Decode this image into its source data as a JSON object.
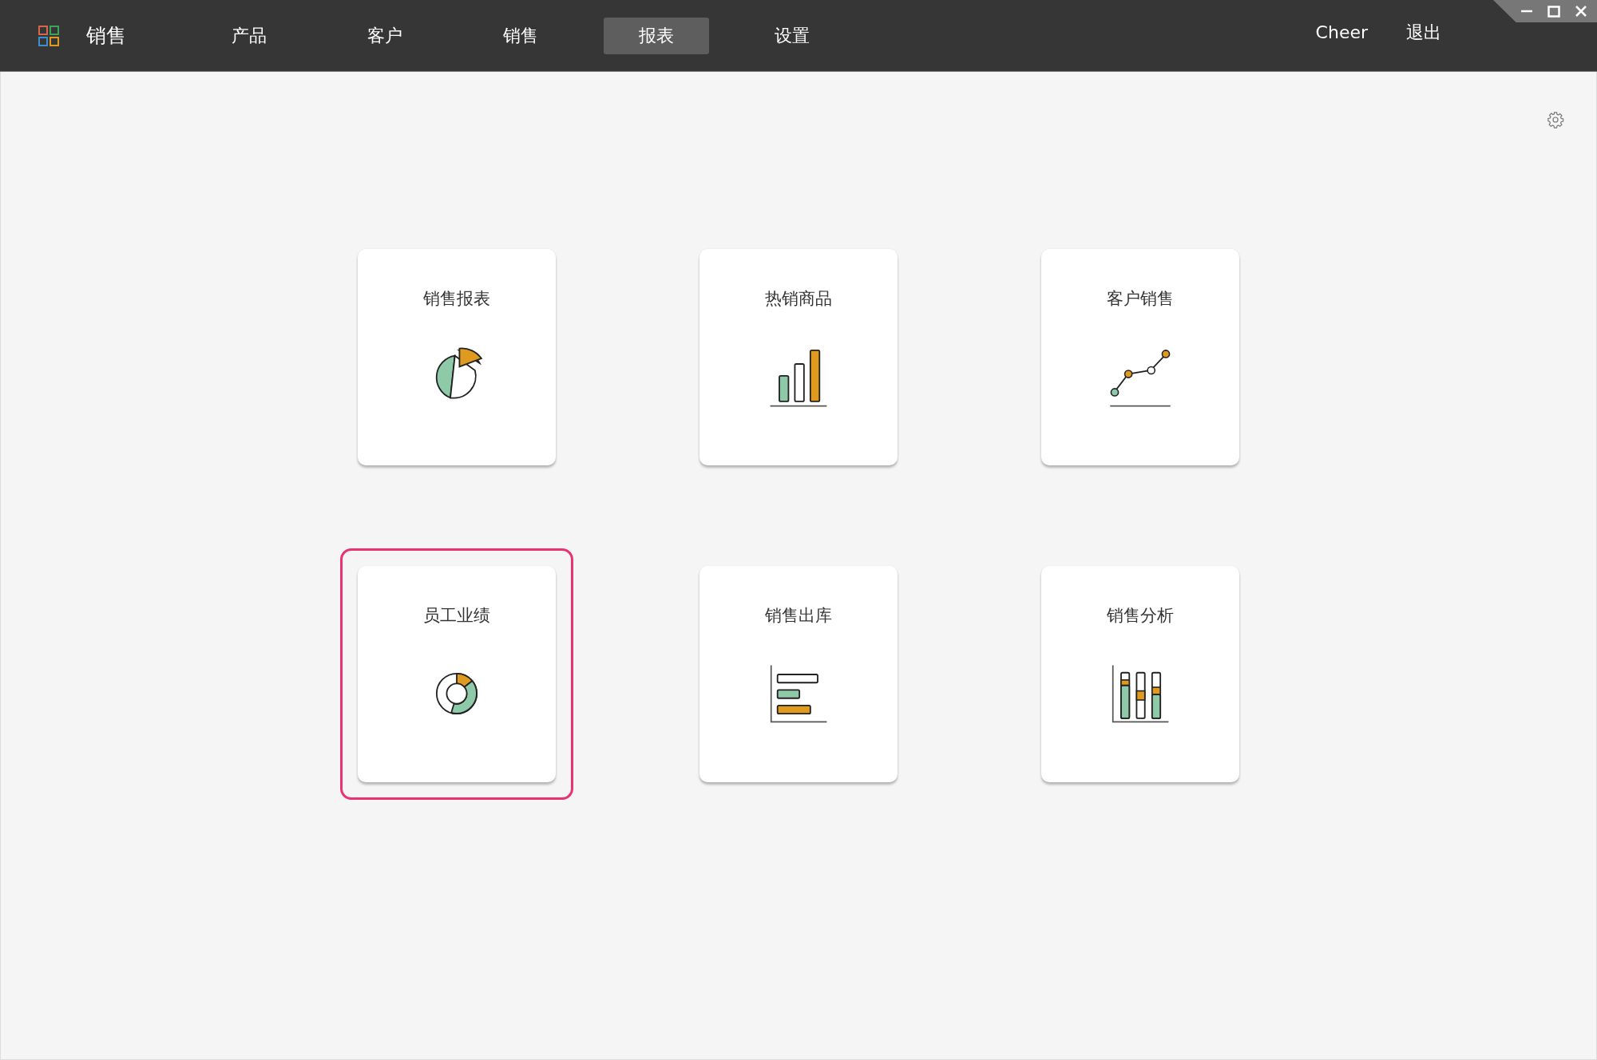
{
  "app": {
    "title": "销售"
  },
  "nav": [
    {
      "label": "产品",
      "selected": false
    },
    {
      "label": "客户",
      "selected": false
    },
    {
      "label": "销售",
      "selected": false
    },
    {
      "label": "报表",
      "selected": true
    },
    {
      "label": "设置",
      "selected": false
    }
  ],
  "user": {
    "name": "Cheer",
    "logout": "退出"
  },
  "reports": [
    {
      "title": "销售报表",
      "kind": "pie",
      "selected": false
    },
    {
      "title": "热销商品",
      "kind": "bar",
      "selected": false
    },
    {
      "title": "客户销售",
      "kind": "line",
      "selected": false
    },
    {
      "title": "员工业绩",
      "kind": "donut",
      "selected": true
    },
    {
      "title": "销售出库",
      "kind": "hbar",
      "selected": false
    },
    {
      "title": "销售分析",
      "kind": "stacked",
      "selected": false
    }
  ]
}
